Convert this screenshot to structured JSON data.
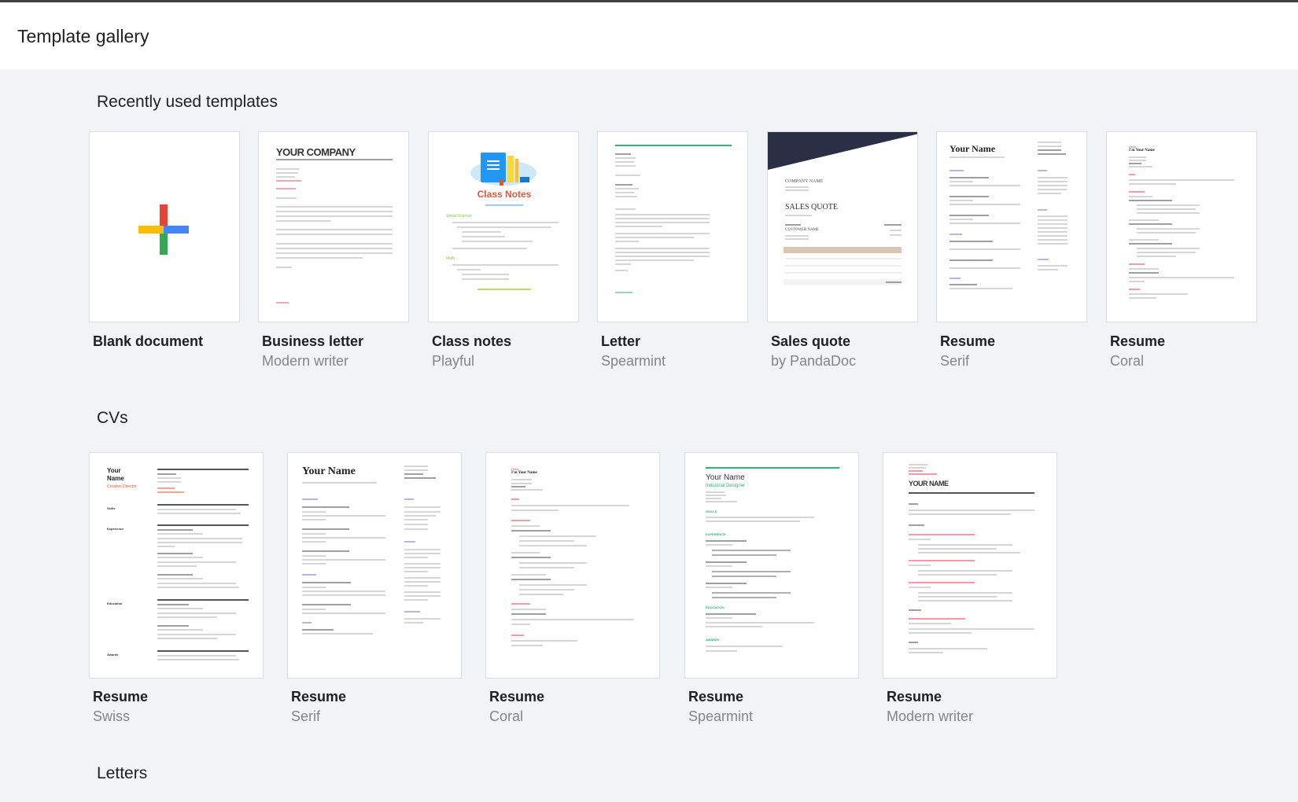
{
  "header": {
    "title": "Template gallery"
  },
  "sections": [
    {
      "title": "Recently used templates",
      "templates": [
        {
          "title": "Blank document",
          "subtitle": ""
        },
        {
          "title": "Business letter",
          "subtitle": "Modern writer"
        },
        {
          "title": "Class notes",
          "subtitle": "Playful"
        },
        {
          "title": "Letter",
          "subtitle": "Spearmint"
        },
        {
          "title": "Sales quote",
          "subtitle": "by PandaDoc"
        },
        {
          "title": "Resume",
          "subtitle": "Serif"
        },
        {
          "title": "Resume",
          "subtitle": "Coral"
        }
      ]
    },
    {
      "title": "CVs",
      "templates": [
        {
          "title": "Resume",
          "subtitle": "Swiss"
        },
        {
          "title": "Resume",
          "subtitle": "Serif"
        },
        {
          "title": "Resume",
          "subtitle": "Coral"
        },
        {
          "title": "Resume",
          "subtitle": "Spearmint"
        },
        {
          "title": "Resume",
          "subtitle": "Modern writer"
        }
      ]
    },
    {
      "title": "Letters"
    }
  ],
  "thumbs": {
    "business_letter": {
      "heading": "YOUR COMPANY"
    },
    "class_notes": {
      "heading": "Class Notes",
      "section1": "Social Science",
      "section2": "Math"
    },
    "sales_quote": {
      "company": "COMPANY NAME",
      "heading": "SALES QUOTE",
      "customer": "CUSTOMER NAME"
    },
    "resume_serif": {
      "name": "Your Name"
    },
    "resume_coral": {
      "greeting": "Hello",
      "name": "I'm Your Name"
    },
    "cv_swiss": {
      "name": "Your Name",
      "role": "Creative Director",
      "labels": [
        "Skills",
        "Experience",
        "Education",
        "Awards"
      ]
    },
    "cv_serif": {
      "name": "Your Name"
    },
    "cv_coral": {
      "greeting": "Hello",
      "name": "I'm Your Name"
    },
    "cv_spearmint": {
      "name": "Your Name",
      "role": "Industrial Designer",
      "labels": [
        "SKILLS",
        "EXPERIENCE",
        "EDUCATION",
        "AWARDS"
      ]
    },
    "cv_modern": {
      "name": "YOUR NAME"
    }
  },
  "colors": {
    "google_red": "#ea4335",
    "google_blue": "#4285f4",
    "google_yellow": "#fbbc04",
    "google_green": "#34a853",
    "coral": "#e8445a",
    "spearmint": "#2bb673",
    "sales_navy": "#2b2f45",
    "sales_tan": "#dcc5b2"
  }
}
